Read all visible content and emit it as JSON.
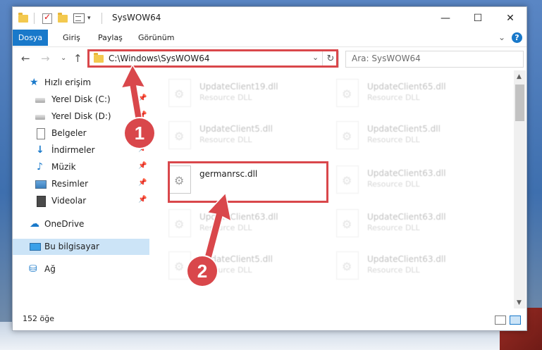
{
  "window": {
    "title": "SysWOW64",
    "minimize_glyph": "—",
    "maximize_glyph": "☐",
    "close_glyph": "✕"
  },
  "ribbon": {
    "tabs": [
      "Dosya",
      "Giriş",
      "Paylaş",
      "Görünüm"
    ],
    "expand_glyph": "⌄",
    "help_glyph": "?"
  },
  "navbar": {
    "back_glyph": "←",
    "forward_glyph": "→",
    "recent_glyph": "⌄",
    "up_glyph": "↑",
    "address": "C:\\Windows\\SysWOW64",
    "address_dropdown_glyph": "⌄",
    "refresh_glyph": "↻",
    "search_placeholder": "Ara: SysWOW64"
  },
  "sidebar": {
    "items": [
      {
        "label": "Hızlı erişim",
        "icon": "quick-access-star-icon"
      },
      {
        "label": "Yerel Disk (C:)",
        "icon": "drive-icon",
        "pinned": true
      },
      {
        "label": "Yerel Disk (D:)",
        "icon": "drive-icon",
        "pinned": true
      },
      {
        "label": "Belgeler",
        "icon": "documents-icon",
        "pinned": true
      },
      {
        "label": "İndirmeler",
        "icon": "downloads-icon",
        "pinned": true
      },
      {
        "label": "Müzik",
        "icon": "music-icon",
        "pinned": true
      },
      {
        "label": "Resimler",
        "icon": "pictures-icon",
        "pinned": true
      },
      {
        "label": "Videolar",
        "icon": "videos-icon",
        "pinned": true
      },
      {
        "label": "OneDrive",
        "icon": "onedrive-cloud-icon"
      },
      {
        "label": "Bu bilgisayar",
        "icon": "this-pc-icon",
        "selected": true
      },
      {
        "label": "Ağ",
        "icon": "network-icon"
      }
    ],
    "pin_glyph": "📌"
  },
  "files": {
    "left_column": [
      {
        "name": "UpdateClient19.dll",
        "desc": "Resource DLL"
      },
      {
        "name": "UpdateClient5.dll",
        "desc": "Resource DLL"
      },
      {
        "name": "germanrsc.dll",
        "desc": ""
      },
      {
        "name": "UpdateClient63.dll",
        "desc": "Resource DLL"
      },
      {
        "name": "UpdateClient5.dll",
        "desc": "Resource DLL"
      }
    ],
    "right_column": [
      {
        "name": "UpdateClient65.dll",
        "desc": "Resource DLL"
      },
      {
        "name": "UpdateClient5.dll",
        "desc": "Resource DLL"
      },
      {
        "name": "UpdateClient63.dll",
        "desc": "Resource DLL"
      },
      {
        "name": "UpdateClient63.dll",
        "desc": "Resource DLL"
      },
      {
        "name": "UpdateClient63.dll",
        "desc": "Resource DLL"
      }
    ]
  },
  "status": {
    "item_count": "152 öğe"
  },
  "callouts": {
    "step1": "1",
    "step2": "2",
    "color": "#d9474b"
  }
}
